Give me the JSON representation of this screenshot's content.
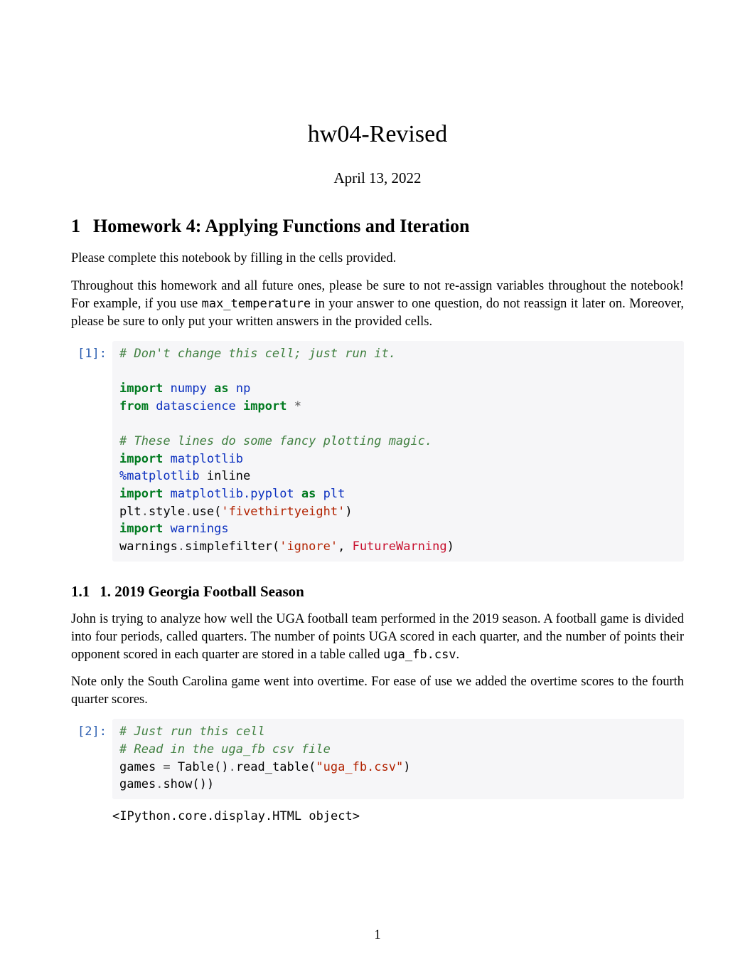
{
  "title": "hw04-Revised",
  "date": "April 13, 2022",
  "section": {
    "num": "1",
    "title": "Homework 4: Applying Functions and Iteration"
  },
  "para1": "Please complete this notebook by filling in the cells provided.",
  "para2a": "Throughout this homework and all future ones, please be sure to not re-assign variables throughout the notebook! For example, if you use ",
  "para2_code": "max_temperature",
  "para2b": " in your answer to one question, do not reassign it later on. Moreover, please be sure to only put your written answers in the provided cells.",
  "cell1": {
    "prompt": "[1]:",
    "l1": "# Don't change this cell; just run it.",
    "kw_import": "import",
    "kw_from": "from",
    "kw_as": "as",
    "mod_numpy": "numpy",
    "name_np": "np",
    "mod_ds": "datascience",
    "star": "*",
    "l5": "# These lines do some fancy plotting magic.",
    "mod_mpl": "matplotlib",
    "magic": "%matplotlib",
    "magic_arg": "inline",
    "mod_plt": "matplotlib.pyplot",
    "name_plt": "plt",
    "plt": "plt",
    "dot": ".",
    "style": "style",
    "use": "use(",
    "str538": "'fivethirtyeight'",
    "rparen": ")",
    "mod_warn": "warnings",
    "warn": "warnings",
    "simplefilter": "simplefilter(",
    "str_ignore": "'ignore'",
    "comma": ", ",
    "futurewarning": "FutureWarning"
  },
  "subsection": {
    "num": "1.1",
    "title": "1. 2019 Georgia Football Season"
  },
  "para3a": "John is trying to analyze how well the UGA football team performed in the 2019 season. A football game is divided into four periods, called quarters. The number of points UGA scored in each quarter, and the number of points their opponent scored in each quarter are stored in a table called ",
  "para3_code": "uga_fb.csv",
  "para3b": ".",
  "para4": "Note only the South Carolina game went into overtime. For ease of use we added the overtime scores to the fourth quarter scores.",
  "cell2": {
    "prompt": "[2]:",
    "l1": "# Just run this cell",
    "l2": "# Read in the uga_fb csv file",
    "games": "games",
    "eq": " = ",
    "table": "Table()",
    "dot": ".",
    "read_table": "read_table(",
    "str_csv": "\"uga_fb.csv\"",
    "rparen": ")",
    "show": "show()"
  },
  "output1": "<IPython.core.display.HTML object>",
  "page_num": "1"
}
